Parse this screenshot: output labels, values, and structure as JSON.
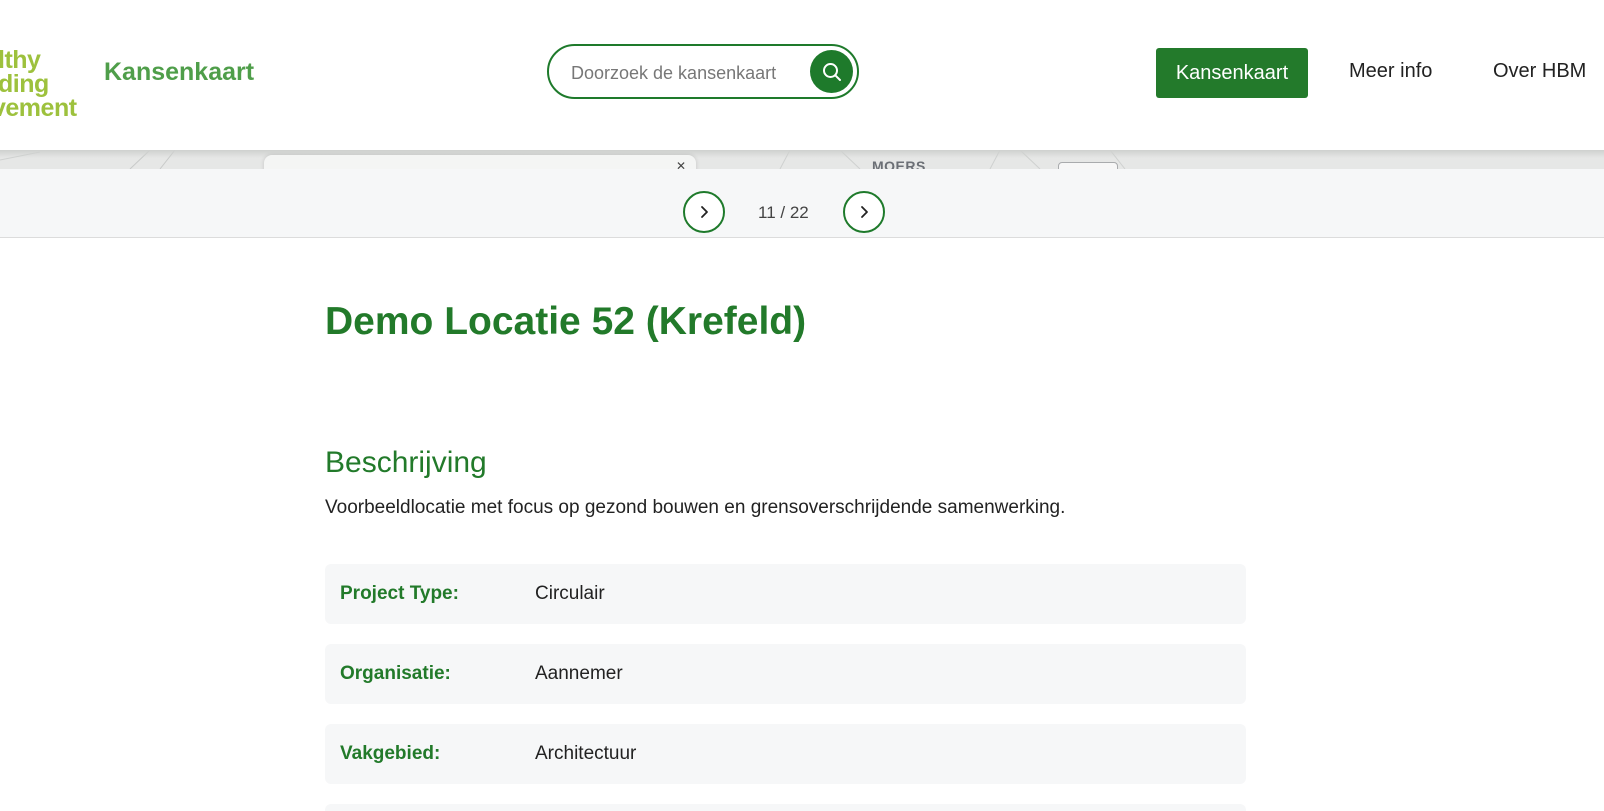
{
  "header": {
    "logo_lines": [
      "lthy",
      "ding",
      "vement"
    ],
    "brand": "Kansenkaart",
    "search": {
      "placeholder": "Doorzoek de kansenkaart",
      "button_icon": "search-icon"
    },
    "nav": [
      {
        "label": "Kansenkaart",
        "active": true
      },
      {
        "label": "Meer info",
        "active": false
      },
      {
        "label": "Over HBM",
        "active": false
      }
    ]
  },
  "map": {
    "place_label": "MOERS"
  },
  "pager": {
    "prev_icon": "chevron-right-icon",
    "next_icon": "chevron-right-icon",
    "count": "11 / 22"
  },
  "detail": {
    "title": "Demo Locatie 52 (Krefeld)",
    "section_title": "Beschrijving",
    "description": "Voorbeeldlocatie met focus op gezond bouwen en grensoverschrijdende samenwerking.",
    "fields": [
      {
        "label": "Project Type:",
        "value": "Circulair"
      },
      {
        "label": "Organisatie:",
        "value": "Aannemer"
      },
      {
        "label": "Vakgebied:",
        "value": "Architectuur"
      }
    ]
  },
  "colors": {
    "primary": "#1e7a2b",
    "brand_text": "#4f9e4a",
    "logo": "#9dc13d",
    "panel_bg": "#f6f7f8"
  }
}
